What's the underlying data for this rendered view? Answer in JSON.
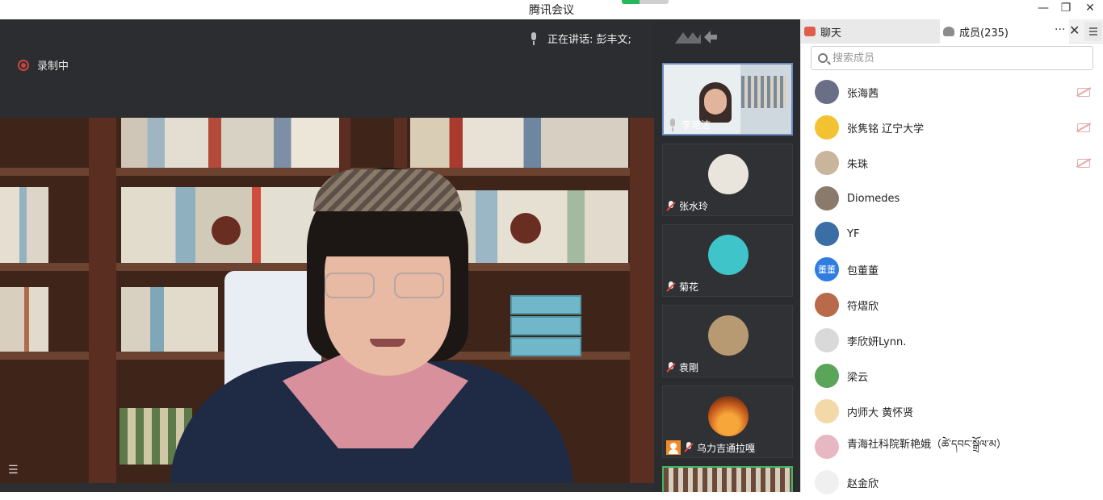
{
  "window": {
    "title": "腾讯会议",
    "controls": {
      "minimize": "—",
      "restore": "❐",
      "close": "✕"
    }
  },
  "meeting": {
    "recording_label": "录制中",
    "speaking_label": "正在讲话: 彭丰文;",
    "list_button": "☰"
  },
  "thumbnails": [
    {
      "name": "李艳洁",
      "muted": false,
      "avatar_color": "#c8d3dc"
    },
    {
      "name": "张水玲",
      "muted": true,
      "avatar_color": "#e9e4dc"
    },
    {
      "name": "菊花",
      "muted": true,
      "avatar_color": "#3ec4c9"
    },
    {
      "name": "袁剛",
      "muted": true,
      "avatar_color": "#b89a72"
    },
    {
      "name": "乌力吉通拉嘎",
      "muted": true,
      "avatar_color": "#e07a1f"
    }
  ],
  "panel": {
    "tab_chat": "聊天",
    "tab_members": "成员(235)",
    "more": "···",
    "close": "✕",
    "search_placeholder": "搜索成员",
    "members": [
      {
        "name": "张海茜",
        "avatar_color": "#6b6f85",
        "avatar_text": "",
        "camera_off": true
      },
      {
        "name": "张隽铭 辽宁大学",
        "avatar_color": "#f2c230",
        "avatar_text": "",
        "camera_off": true
      },
      {
        "name": "朱珠",
        "avatar_color": "#c9b59c",
        "avatar_text": "",
        "camera_off": true
      },
      {
        "name": "Diomedes",
        "avatar_color": "#8a7a6c",
        "avatar_text": "",
        "camera_off": false
      },
      {
        "name": "YF",
        "avatar_color": "#3a6ea5",
        "avatar_text": "",
        "camera_off": false
      },
      {
        "name": "包董董",
        "avatar_color": "#2f7de1",
        "avatar_text": "董董",
        "camera_off": false
      },
      {
        "name": "符熠欣",
        "avatar_color": "#b86a4a",
        "avatar_text": "",
        "camera_off": false
      },
      {
        "name": "李欣妍Lynn.",
        "avatar_color": "#d9d9d9",
        "avatar_text": "",
        "camera_off": false
      },
      {
        "name": "梁云",
        "avatar_color": "#5aa55a",
        "avatar_text": "",
        "camera_off": false
      },
      {
        "name": "内师大 黄怀贤",
        "avatar_color": "#f4d9a8",
        "avatar_text": "",
        "camera_off": false
      },
      {
        "name": "青海社科院靳艳娥（ཚེ་དབང་སྒྲོལ་མ）",
        "avatar_color": "#e8b8c2",
        "avatar_text": "",
        "camera_off": false
      },
      {
        "name": "赵金欣",
        "avatar_color": "#f0f0f0",
        "avatar_text": "",
        "camera_off": false
      }
    ]
  }
}
